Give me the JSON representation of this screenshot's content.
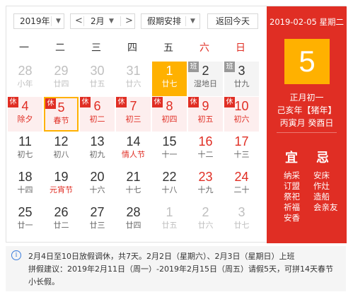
{
  "toolbar": {
    "year": "2019年",
    "prev": "<",
    "month": "2月",
    "next": ">",
    "holiday": "假期安排",
    "today_button": "返回今天"
  },
  "weekdays": [
    "一",
    "二",
    "三",
    "四",
    "五",
    "六",
    "日"
  ],
  "days": [
    {
      "num": "28",
      "sub": "小年",
      "style": "other"
    },
    {
      "num": "29",
      "sub": "廿四",
      "style": "other"
    },
    {
      "num": "30",
      "sub": "廿五",
      "style": "other"
    },
    {
      "num": "31",
      "sub": "廿六",
      "style": "other"
    },
    {
      "num": "1",
      "sub": "廿七",
      "style": "today"
    },
    {
      "num": "2",
      "sub": "湿地日",
      "style": "work",
      "tag": "班"
    },
    {
      "num": "3",
      "sub": "廿九",
      "style": "work",
      "tag": "班"
    },
    {
      "num": "4",
      "sub": "除夕",
      "style": "rest",
      "tag": "休"
    },
    {
      "num": "5",
      "sub": "春节",
      "style": "rest selected",
      "tag": "休"
    },
    {
      "num": "6",
      "sub": "初二",
      "style": "rest",
      "tag": "休"
    },
    {
      "num": "7",
      "sub": "初三",
      "style": "rest",
      "tag": "休"
    },
    {
      "num": "8",
      "sub": "初四",
      "style": "rest",
      "tag": "休"
    },
    {
      "num": "9",
      "sub": "初五",
      "style": "rest",
      "tag": "休"
    },
    {
      "num": "10",
      "sub": "初六",
      "style": "rest",
      "tag": "休"
    },
    {
      "num": "11",
      "sub": "初七",
      "style": ""
    },
    {
      "num": "12",
      "sub": "初八",
      "style": ""
    },
    {
      "num": "13",
      "sub": "初九",
      "style": ""
    },
    {
      "num": "14",
      "sub": "情人节",
      "style": "red-sub"
    },
    {
      "num": "15",
      "sub": "十一",
      "style": ""
    },
    {
      "num": "16",
      "sub": "十二",
      "style": "wkend"
    },
    {
      "num": "17",
      "sub": "十三",
      "style": "wkend"
    },
    {
      "num": "18",
      "sub": "十四",
      "style": ""
    },
    {
      "num": "19",
      "sub": "元宵节",
      "style": "red-sub"
    },
    {
      "num": "20",
      "sub": "十六",
      "style": ""
    },
    {
      "num": "21",
      "sub": "十七",
      "style": ""
    },
    {
      "num": "22",
      "sub": "十八",
      "style": ""
    },
    {
      "num": "23",
      "sub": "十九",
      "style": "wkend"
    },
    {
      "num": "24",
      "sub": "二十",
      "style": "wkend"
    },
    {
      "num": "25",
      "sub": "廿一",
      "style": ""
    },
    {
      "num": "26",
      "sub": "廿二",
      "style": ""
    },
    {
      "num": "27",
      "sub": "廿三",
      "style": ""
    },
    {
      "num": "28",
      "sub": "廿四",
      "style": ""
    },
    {
      "num": "1",
      "sub": "廿五",
      "style": "other"
    },
    {
      "num": "2",
      "sub": "廿六",
      "style": "other"
    },
    {
      "num": "3",
      "sub": "廿七",
      "style": "other"
    }
  ],
  "panel": {
    "date": "2019-02-05 星期二",
    "day": "5",
    "lunar": "正月初一",
    "ganzhi_year": "己亥年【猪年】",
    "ganzhi_month_day": "丙寅月 癸酉日",
    "yi_label": "宜",
    "ji_label": "忌",
    "yi": [
      "纳采",
      "订盟",
      "祭祀",
      "祈福",
      "安香"
    ],
    "ji": [
      "安床",
      "作灶",
      "造船",
      "会亲友"
    ]
  },
  "info": {
    "line1": "2月4日至10日放假调休，共7天。2月2日（星期六）、2月3日（星期日）上班",
    "line2": "拼假建议：2019年2月11日（周一）-2019年2月15日（周五）请假5天，可拼14天春节",
    "line3": "小长假。"
  },
  "colors": {
    "accent_red": "#e02e24",
    "highlight_orange": "#ffb100",
    "rest_bg": "#fdeeee",
    "work_bg": "#f4f4f4"
  }
}
